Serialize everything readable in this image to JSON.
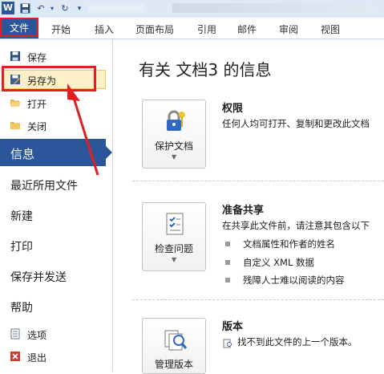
{
  "qat": {
    "logo": "W"
  },
  "tabs": {
    "file": "文件",
    "home": "开始",
    "insert": "插入",
    "layout": "页面布局",
    "references": "引用",
    "mailings": "邮件",
    "review": "审阅",
    "view": "视图"
  },
  "menu": {
    "save": "保存",
    "saveas": "另存为",
    "open": "打开",
    "close": "关闭",
    "info": "信息",
    "recent": "最近所用文件",
    "new": "新建",
    "print": "打印",
    "save_send": "保存并发送",
    "help": "帮助",
    "options": "选项",
    "exit": "退出"
  },
  "main": {
    "title": "有关 文档3 的信息",
    "permissions": {
      "button": "保护文档",
      "heading": "权限",
      "text": "任何人均可打开、复制和更改此文档"
    },
    "share": {
      "button": "检查问题",
      "heading": "准备共享",
      "text": "在共享此文件前，请注意其包含以下",
      "bullets": [
        "文档属性和作者的姓名",
        "自定义 XML 数据",
        "残障人士难以阅读的内容"
      ]
    },
    "versions": {
      "button": "管理版本",
      "heading": "版本",
      "text": "找不到此文件的上一个版本。"
    }
  },
  "colors": {
    "accent": "#2b579a",
    "highlight": "#e02020"
  }
}
